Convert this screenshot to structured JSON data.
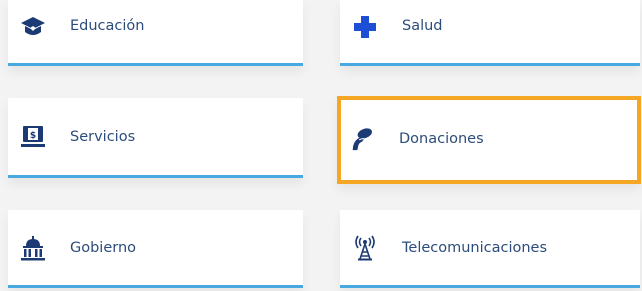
{
  "colors": {
    "accent_line": "#4aa8e0",
    "label_text": "#2c4c7c",
    "icon_navy": "#1c3a73",
    "health_blue": "#1d4fd6",
    "highlight": "#f5a623"
  },
  "categories": [
    {
      "label": "Educación",
      "icon": "graduation-cap-icon"
    },
    {
      "label": "Salud",
      "icon": "medical-cross-icon"
    },
    {
      "label": "Servicios",
      "icon": "computer-bill-icon"
    },
    {
      "label": "Donaciones",
      "icon": "giving-hand-icon",
      "selected": true
    },
    {
      "label": "Gobierno",
      "icon": "government-building-icon"
    },
    {
      "label": "Telecomunicaciones",
      "icon": "antenna-icon"
    }
  ]
}
